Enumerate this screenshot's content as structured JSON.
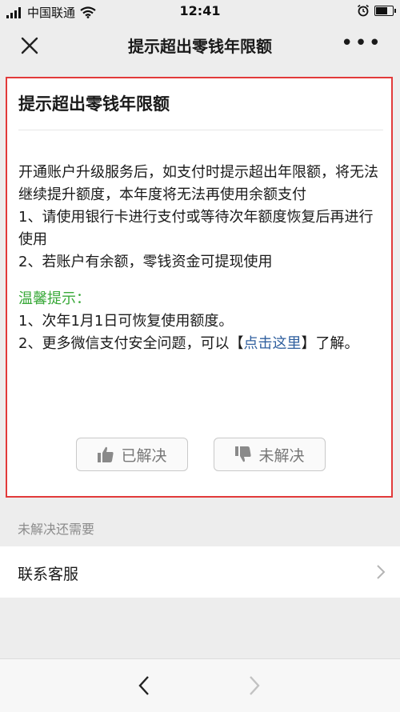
{
  "status_bar": {
    "carrier": "中国联通",
    "time": "12:41",
    "battery_level": 0.8
  },
  "nav": {
    "title": "提示超出零钱年限额"
  },
  "card": {
    "title": "提示超出零钱年限额",
    "paragraph": "开通账户升级服务后，如支付时提示超出年限额，将无法继续提升额度，本年度将无法再使用余额支付",
    "item1": "1、请使用银行卡进行支付或等待次年额度恢复后再进行使用",
    "item2": "2、若账户有余额，零钱资金可提现使用",
    "tip_title": "温馨提示：",
    "tip1": "1、次年1月1日可恢复使用额度。",
    "tip2_before": "2、更多微信支付安全问题，可以【",
    "tip2_link": "点击这里",
    "tip2_after": "】了解。",
    "solved_label": "已解决",
    "unsolved_label": "未解决"
  },
  "help": {
    "section_label": "未解决还需要",
    "contact_label": "联系客服"
  },
  "colors": {
    "accent_green": "#3aa93a",
    "link_blue": "#2f5f9e",
    "highlight_red": "#e23a3a"
  }
}
